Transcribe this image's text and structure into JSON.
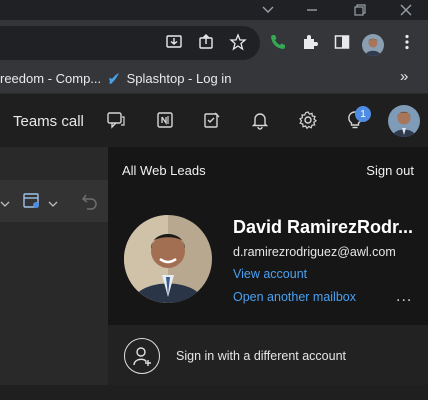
{
  "browser": {
    "bookmarks": [
      {
        "label": "reedom - Comp..."
      },
      {
        "label": "Splashtop - Log in"
      }
    ],
    "bookmarks_more": "»"
  },
  "app": {
    "title": "Teams call",
    "notification_count": "1"
  },
  "flyout": {
    "org": "All Web Leads",
    "sign_out": "Sign out",
    "name": "David RamirezRodr...",
    "email": "d.ramirezrodriguez@awl.com",
    "view_account": "View account",
    "open_mailbox": "Open another mailbox",
    "more": "...",
    "sign_in_other": "Sign in with a different account"
  },
  "colors": {
    "link": "#4aa0f0",
    "badge": "#4f8ce3",
    "phone_icon": "#34a853"
  }
}
